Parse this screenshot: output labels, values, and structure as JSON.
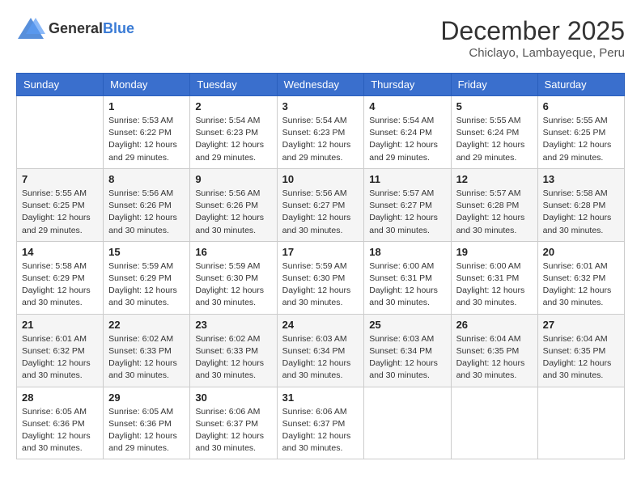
{
  "logo": {
    "general": "General",
    "blue": "Blue"
  },
  "title": {
    "month": "December 2025",
    "location": "Chiclayo, Lambayeque, Peru"
  },
  "weekdays": [
    "Sunday",
    "Monday",
    "Tuesday",
    "Wednesday",
    "Thursday",
    "Friday",
    "Saturday"
  ],
  "weeks": [
    [
      {
        "day": "",
        "info": ""
      },
      {
        "day": "1",
        "info": "Sunrise: 5:53 AM\nSunset: 6:22 PM\nDaylight: 12 hours\nand 29 minutes."
      },
      {
        "day": "2",
        "info": "Sunrise: 5:54 AM\nSunset: 6:23 PM\nDaylight: 12 hours\nand 29 minutes."
      },
      {
        "day": "3",
        "info": "Sunrise: 5:54 AM\nSunset: 6:23 PM\nDaylight: 12 hours\nand 29 minutes."
      },
      {
        "day": "4",
        "info": "Sunrise: 5:54 AM\nSunset: 6:24 PM\nDaylight: 12 hours\nand 29 minutes."
      },
      {
        "day": "5",
        "info": "Sunrise: 5:55 AM\nSunset: 6:24 PM\nDaylight: 12 hours\nand 29 minutes."
      },
      {
        "day": "6",
        "info": "Sunrise: 5:55 AM\nSunset: 6:25 PM\nDaylight: 12 hours\nand 29 minutes."
      }
    ],
    [
      {
        "day": "7",
        "info": "Sunrise: 5:55 AM\nSunset: 6:25 PM\nDaylight: 12 hours\nand 29 minutes."
      },
      {
        "day": "8",
        "info": "Sunrise: 5:56 AM\nSunset: 6:26 PM\nDaylight: 12 hours\nand 30 minutes."
      },
      {
        "day": "9",
        "info": "Sunrise: 5:56 AM\nSunset: 6:26 PM\nDaylight: 12 hours\nand 30 minutes."
      },
      {
        "day": "10",
        "info": "Sunrise: 5:56 AM\nSunset: 6:27 PM\nDaylight: 12 hours\nand 30 minutes."
      },
      {
        "day": "11",
        "info": "Sunrise: 5:57 AM\nSunset: 6:27 PM\nDaylight: 12 hours\nand 30 minutes."
      },
      {
        "day": "12",
        "info": "Sunrise: 5:57 AM\nSunset: 6:28 PM\nDaylight: 12 hours\nand 30 minutes."
      },
      {
        "day": "13",
        "info": "Sunrise: 5:58 AM\nSunset: 6:28 PM\nDaylight: 12 hours\nand 30 minutes."
      }
    ],
    [
      {
        "day": "14",
        "info": "Sunrise: 5:58 AM\nSunset: 6:29 PM\nDaylight: 12 hours\nand 30 minutes."
      },
      {
        "day": "15",
        "info": "Sunrise: 5:59 AM\nSunset: 6:29 PM\nDaylight: 12 hours\nand 30 minutes."
      },
      {
        "day": "16",
        "info": "Sunrise: 5:59 AM\nSunset: 6:30 PM\nDaylight: 12 hours\nand 30 minutes."
      },
      {
        "day": "17",
        "info": "Sunrise: 5:59 AM\nSunset: 6:30 PM\nDaylight: 12 hours\nand 30 minutes."
      },
      {
        "day": "18",
        "info": "Sunrise: 6:00 AM\nSunset: 6:31 PM\nDaylight: 12 hours\nand 30 minutes."
      },
      {
        "day": "19",
        "info": "Sunrise: 6:00 AM\nSunset: 6:31 PM\nDaylight: 12 hours\nand 30 minutes."
      },
      {
        "day": "20",
        "info": "Sunrise: 6:01 AM\nSunset: 6:32 PM\nDaylight: 12 hours\nand 30 minutes."
      }
    ],
    [
      {
        "day": "21",
        "info": "Sunrise: 6:01 AM\nSunset: 6:32 PM\nDaylight: 12 hours\nand 30 minutes."
      },
      {
        "day": "22",
        "info": "Sunrise: 6:02 AM\nSunset: 6:33 PM\nDaylight: 12 hours\nand 30 minutes."
      },
      {
        "day": "23",
        "info": "Sunrise: 6:02 AM\nSunset: 6:33 PM\nDaylight: 12 hours\nand 30 minutes."
      },
      {
        "day": "24",
        "info": "Sunrise: 6:03 AM\nSunset: 6:34 PM\nDaylight: 12 hours\nand 30 minutes."
      },
      {
        "day": "25",
        "info": "Sunrise: 6:03 AM\nSunset: 6:34 PM\nDaylight: 12 hours\nand 30 minutes."
      },
      {
        "day": "26",
        "info": "Sunrise: 6:04 AM\nSunset: 6:35 PM\nDaylight: 12 hours\nand 30 minutes."
      },
      {
        "day": "27",
        "info": "Sunrise: 6:04 AM\nSunset: 6:35 PM\nDaylight: 12 hours\nand 30 minutes."
      }
    ],
    [
      {
        "day": "28",
        "info": "Sunrise: 6:05 AM\nSunset: 6:36 PM\nDaylight: 12 hours\nand 30 minutes."
      },
      {
        "day": "29",
        "info": "Sunrise: 6:05 AM\nSunset: 6:36 PM\nDaylight: 12 hours\nand 29 minutes."
      },
      {
        "day": "30",
        "info": "Sunrise: 6:06 AM\nSunset: 6:37 PM\nDaylight: 12 hours\nand 30 minutes."
      },
      {
        "day": "31",
        "info": "Sunrise: 6:06 AM\nSunset: 6:37 PM\nDaylight: 12 hours\nand 30 minutes."
      },
      {
        "day": "",
        "info": ""
      },
      {
        "day": "",
        "info": ""
      },
      {
        "day": "",
        "info": ""
      }
    ]
  ]
}
